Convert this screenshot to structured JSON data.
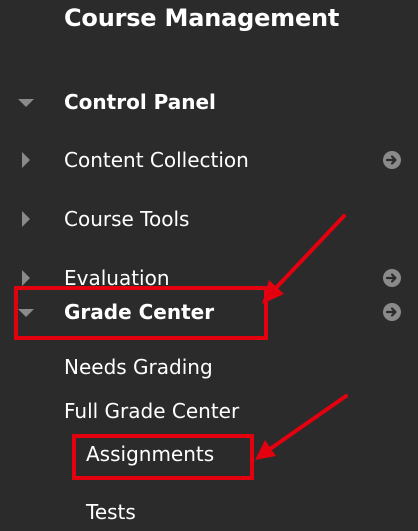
{
  "header": {
    "course_title": "Course Management"
  },
  "nav": {
    "control_panel": "Control Panel",
    "content_collection": "Content Collection",
    "course_tools": "Course Tools",
    "evaluation": "Evaluation",
    "grade_center": "Grade Center"
  },
  "grade_center_items": {
    "needs_grading": "Needs Grading",
    "full_grade_center": "Full Grade Center",
    "assignments": "Assignments",
    "tests": "Tests"
  },
  "colors": {
    "panel_bg": "#2b2b2b",
    "text": "#ffffff",
    "arrow_icon": "#8a8a8a",
    "highlight": "#e3000f"
  },
  "icons": {
    "expanded": "triangle-down-icon",
    "collapsed": "triangle-right-icon",
    "go": "circle-arrow-right-icon"
  }
}
